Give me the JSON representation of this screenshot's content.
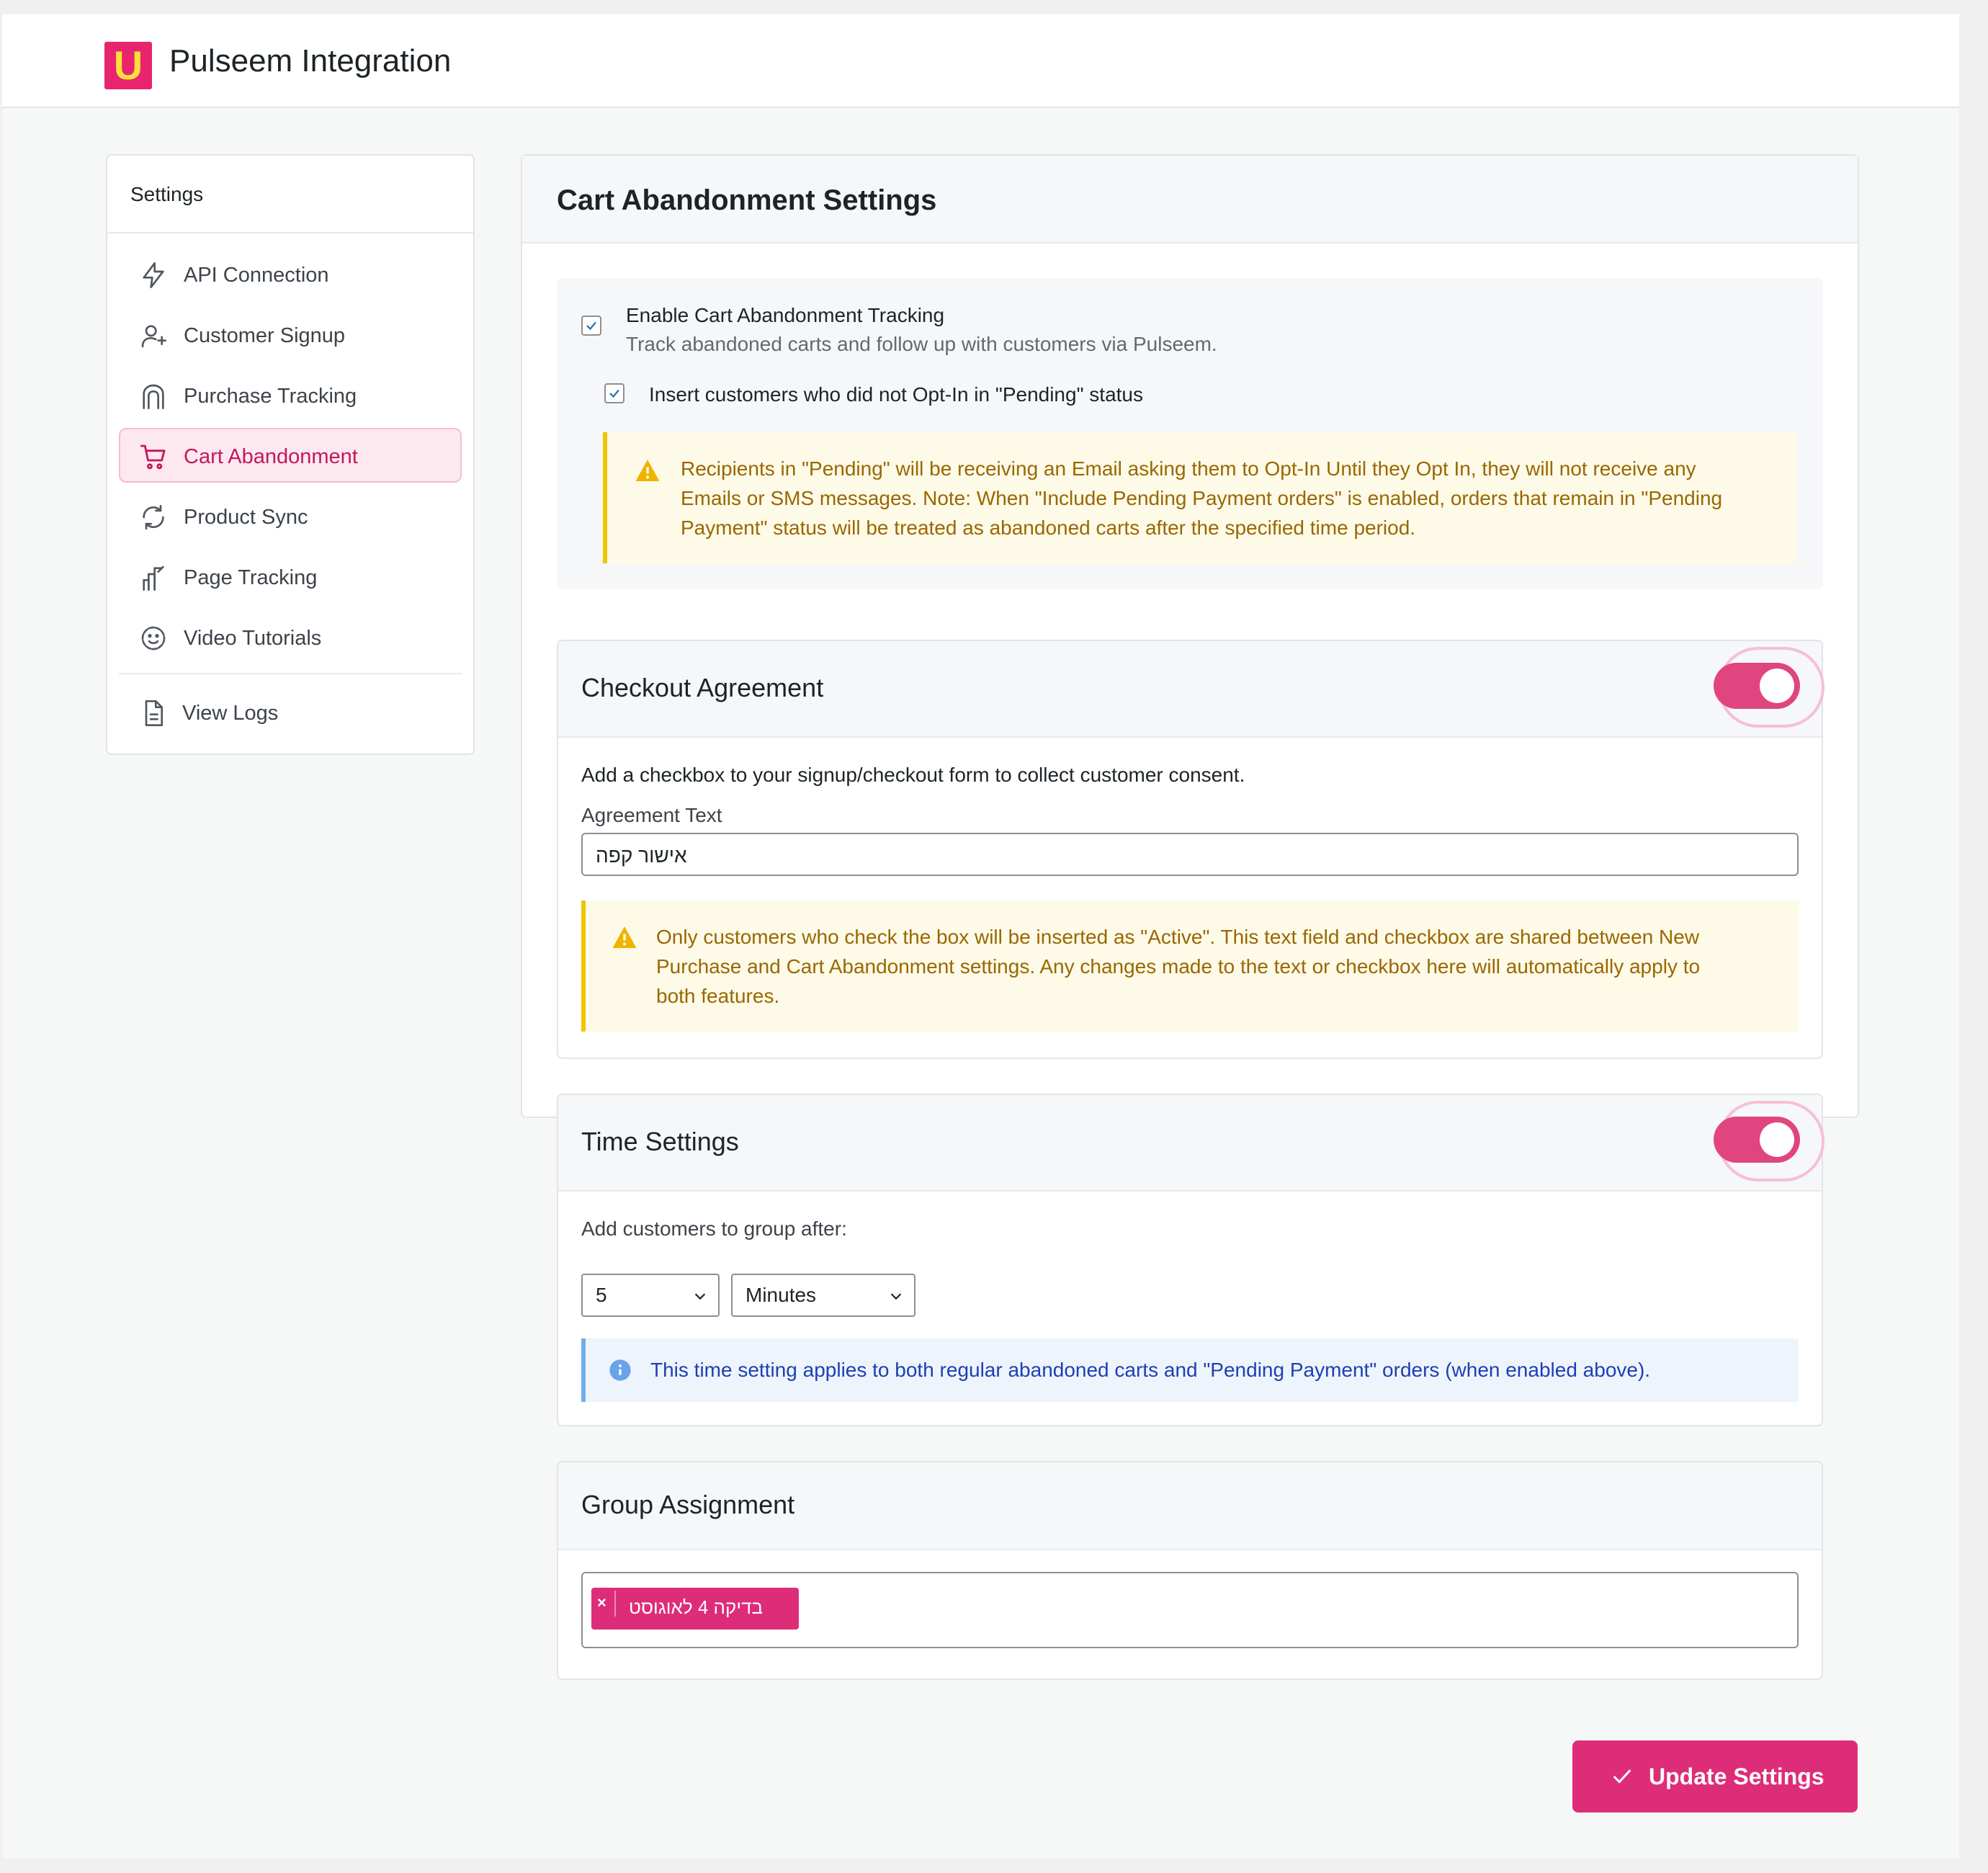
{
  "app": {
    "title": "Pulseem Integration",
    "logo_icon": "pulseem-logo"
  },
  "colors": {
    "accent": "#de2d78",
    "warning_text": "#9a6700",
    "info_text": "#1d3fb5"
  },
  "sidebar": {
    "heading": "Settings",
    "items": [
      {
        "label": "API Connection",
        "icon": "lightning-icon"
      },
      {
        "label": "Customer Signup",
        "icon": "user-plus-icon"
      },
      {
        "label": "Purchase Tracking",
        "icon": "shopping-bag-icon"
      },
      {
        "label": "Cart Abandonment",
        "icon": "cart-icon",
        "active": true
      },
      {
        "label": "Product Sync",
        "icon": "sync-icon"
      },
      {
        "label": "Page Tracking",
        "icon": "chart-icon"
      },
      {
        "label": "Video Tutorials",
        "icon": "smile-icon"
      }
    ],
    "footer_item": {
      "label": "View Logs",
      "icon": "document-icon"
    }
  },
  "main": {
    "title": "Cart Abandonment Settings",
    "enable": {
      "label": "Enable Cart Abandonment Tracking",
      "description": "Track abandoned carts and follow up with customers via Pulseem.",
      "checked": true,
      "pending_label": "Insert customers who did not Opt-In in \"Pending\" status",
      "pending_checked": true,
      "notice_line1": "Recipients in \"Pending\" will be receiving an Email asking them to Opt-In Until they Opt In, they will not receive any",
      "notice_line2": "Emails or SMS messages. Note: When \"Include Pending Payment orders\" is enabled, orders that remain in \"Pending",
      "notice_line3": "Payment\" status will be treated as abandoned carts after the specified time period."
    },
    "checkout": {
      "title": "Checkout Agreement",
      "enabled": true,
      "description": "Add a checkbox to your signup/checkout form to collect customer consent.",
      "field_label": "Agreement Text",
      "field_value": "אישור קפה",
      "notice_line1": "Only customers who check the box will be inserted as \"Active\". This text field and checkbox are shared between New",
      "notice_line2": "Purchase and Cart Abandonment settings. Any changes made to the text or checkbox here will automatically apply to",
      "notice_line3": "both features."
    },
    "time": {
      "title": "Time Settings",
      "enabled": true,
      "label": "Add customers to group after:",
      "amount": "5",
      "unit": "Minutes",
      "info": "This time setting applies to both regular abandoned carts and \"Pending Payment\" orders (when enabled above)."
    },
    "group": {
      "title": "Group Assignment",
      "tag_label": "בדיקה 4 לאוגוסט",
      "tag_remove": "×"
    }
  },
  "update_button": {
    "label": "Update Settings"
  }
}
